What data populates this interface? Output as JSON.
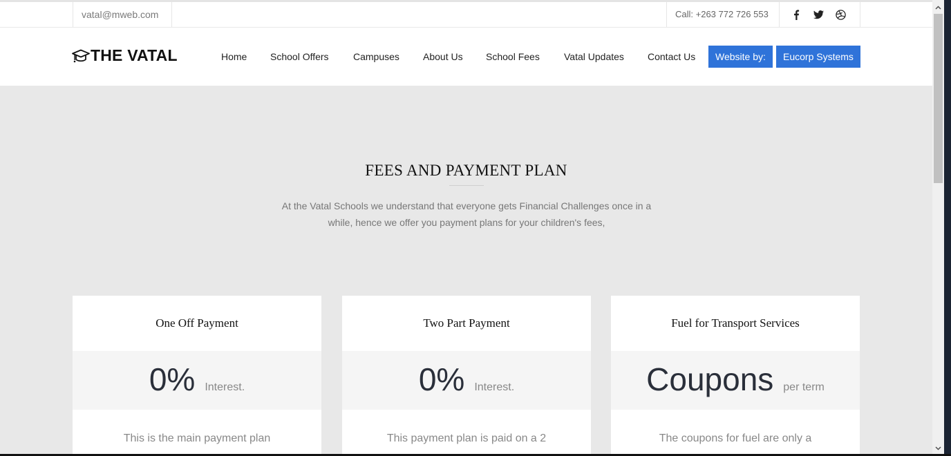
{
  "topbar": {
    "email": "vatal@mweb.com",
    "phone": "Call: +263 772 726 553",
    "socials": [
      "facebook-icon",
      "twitter-icon",
      "dribbble-icon"
    ]
  },
  "brand": {
    "name": "THE VATAL",
    "icon": "graduation-cap-icon"
  },
  "nav": {
    "items": [
      "Home",
      "School Offers",
      "Campuses",
      "About Us",
      "School Fees",
      "Vatal Updates",
      "Contact Us"
    ],
    "buttons": [
      "Website by:",
      "Eucorp Systems"
    ]
  },
  "section": {
    "title": "FEES AND PAYMENT PLAN",
    "description_line1": "At the Vatal Schools we understand that everyone gets Financial Challenges once in a",
    "description_line2": "while, hence we offer you payment plans for your children's fees,"
  },
  "cards": [
    {
      "title": "One Off Payment",
      "value": "0%",
      "unit": "Interest.",
      "description": "This is the main payment plan"
    },
    {
      "title": "Two Part Payment",
      "value": "0%",
      "unit": "Interest.",
      "description": "This payment plan is paid on a 2"
    },
    {
      "title": "Fuel for Transport Services",
      "value": "Coupons",
      "unit": "per term",
      "description": "The coupons for fuel are only a"
    }
  ],
  "colors": {
    "accent": "#2f73d9",
    "background": "#e8e8e8",
    "text": "#111111"
  }
}
